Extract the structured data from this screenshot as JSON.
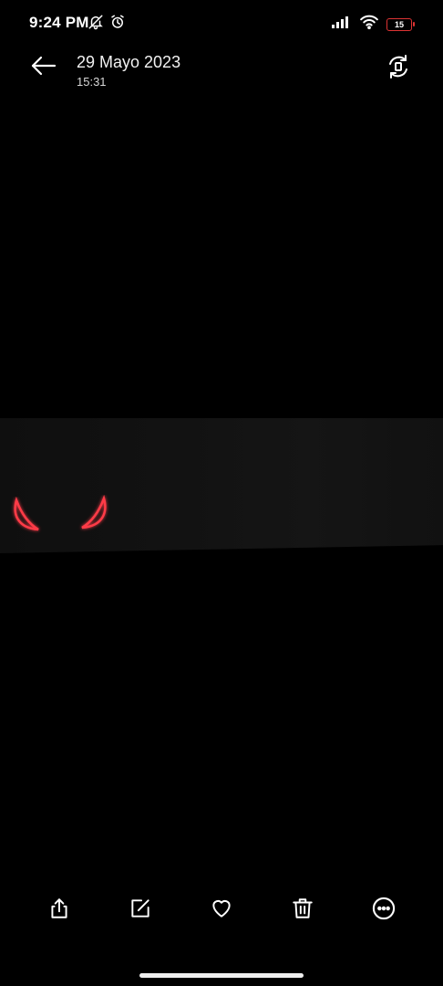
{
  "status_bar": {
    "time": "9:24 PM",
    "battery_level": "15",
    "icons": [
      "bell-off-icon",
      "alarm-icon",
      "signal-icon",
      "wifi-icon",
      "battery-icon"
    ]
  },
  "header": {
    "title": "29 Mayo 2023",
    "subtitle": "15:31",
    "icons": [
      "back-arrow-icon",
      "rotate-icon"
    ]
  },
  "photo": {
    "description_icons": [
      "devil-horn-left-icon",
      "devil-horn-right-icon"
    ],
    "horn_color": "#ff3b47"
  },
  "toolbar": {
    "icons": [
      "share-icon",
      "edit-icon",
      "heart-icon",
      "trash-icon",
      "more-icon"
    ]
  }
}
